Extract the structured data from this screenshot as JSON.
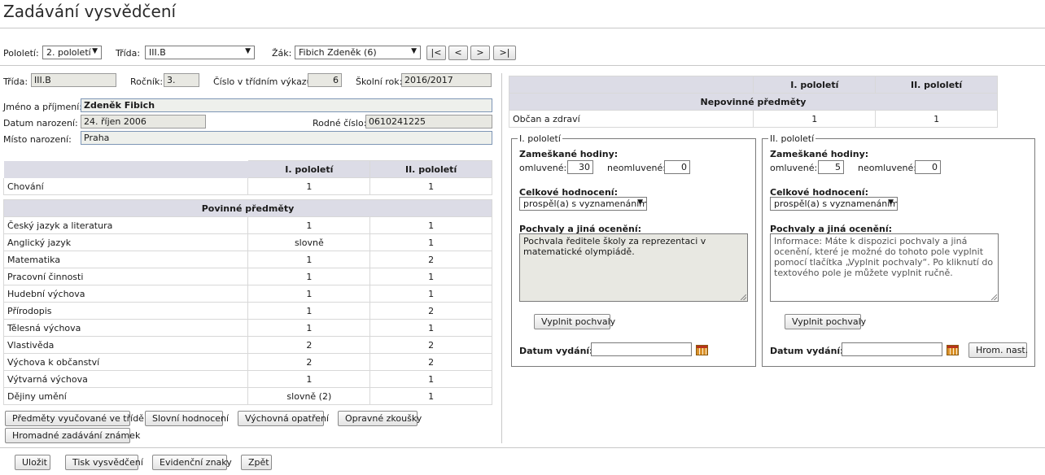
{
  "title": "Zadávání vysvědčení",
  "filters": {
    "pololeti_label": "Pololetí:",
    "pololeti_value": "2. pololetí",
    "trida_label": "Třída:",
    "trida_value": "III.B",
    "zak_label": "Žák:",
    "zak_value": "Fibich Zdeněk (6)",
    "nav_first": "|<",
    "nav_prev": "<",
    "nav_next": ">",
    "nav_last": ">|"
  },
  "student": {
    "trida_label": "Třída:",
    "trida_value": "III.B",
    "rocnik_label": "Ročník:",
    "rocnik_value": "3.",
    "cislo_label": "Číslo v třídním výkazu:",
    "cislo_value": "6",
    "rok_label": "Školní rok:",
    "rok_value": "2016/2017",
    "jmeno_label": "Jméno a příjmení:",
    "jmeno_value": "Zdeněk Fibich",
    "datum_label": "Datum narození:",
    "datum_value": "24. říjen 2006",
    "rc_label": "Rodné číslo:",
    "rc_value": "0610241225",
    "misto_label": "Místo narození:",
    "misto_value": "Praha"
  },
  "grades": {
    "col1": "I. pololetí",
    "col2": "II. pololetí",
    "chovani": {
      "name": "Chování",
      "h1": "1",
      "h2": "1"
    },
    "povinne_title": "Povinné předměty",
    "subjects": [
      {
        "name": "Český jazyk a literatura",
        "h1": "1",
        "h2": "1"
      },
      {
        "name": "Anglický jazyk",
        "h1": "slovně",
        "h2": "1"
      },
      {
        "name": "Matematika",
        "h1": "1",
        "h2": "2"
      },
      {
        "name": "Pracovní činnosti",
        "h1": "1",
        "h2": "1"
      },
      {
        "name": "Hudební výchova",
        "h1": "1",
        "h2": "1"
      },
      {
        "name": "Přírodopis",
        "h1": "1",
        "h2": "2"
      },
      {
        "name": "Tělesná výchova",
        "h1": "1",
        "h2": "1"
      },
      {
        "name": "Vlastivěda",
        "h1": "2",
        "h2": "2"
      },
      {
        "name": "Výchova k občanství",
        "h1": "2",
        "h2": "2"
      },
      {
        "name": "Výtvarná výchova",
        "h1": "1",
        "h2": "1"
      },
      {
        "name": "Dějiny umění",
        "h1": "slovně (2)",
        "h2": "1"
      }
    ]
  },
  "left_buttons": {
    "predmety": "Předměty vyučované ve třídě",
    "slovni": "Slovní hodnocení",
    "vychovna": "Výchovná opatření",
    "opravne": "Opravné zkoušky",
    "hromadne": "Hromadné zadávání známek"
  },
  "nepovinne": {
    "col1": "I. pololetí",
    "col2": "II. pololetí",
    "title": "Nepovinné předměty",
    "rows": [
      {
        "name": "Občan a zdraví",
        "h1": "1",
        "h2": "1"
      }
    ]
  },
  "term1": {
    "legend": "I. pololetí",
    "absence_label": "Zameškané hodiny:",
    "omluvene_label": "omluvené:",
    "omluvene_value": "30",
    "neomluvene_label": "neomluvené:",
    "neomluvene_value": "0",
    "overall_label": "Celkové hodnocení:",
    "overall_value": "prospěl(a) s vyznamenáním",
    "praise_label": "Pochvaly a jiná ocenění:",
    "praise_text": "Pochvala ředitele školy za reprezentaci v matematické olympiádě.",
    "fill_button": "Vyplnit pochvaly",
    "date_label": "Datum vydání:",
    "date_value": ""
  },
  "term2": {
    "legend": "II. pololetí",
    "absence_label": "Zameškané hodiny:",
    "omluvene_label": "omluvené:",
    "omluvene_value": "5",
    "neomluvene_label": "neomluvené:",
    "neomluvene_value": "0",
    "overall_label": "Celkové hodnocení:",
    "overall_value": "prospěl(a) s vyznamenáním",
    "praise_label": "Pochvaly a jiná ocenění:",
    "praise_text": "Informace: Máte k dispozici pochvaly a jiná ocenění, které je možné do tohoto pole vyplnit pomocí tlačítka „Vyplnit pochvaly“. Po kliknutí do textového pole je můžete vyplnit ručně.",
    "fill_button": "Vyplnit pochvaly",
    "date_label": "Datum vydání:",
    "date_value": "",
    "hrom_button": "Hrom. nast."
  },
  "footer": {
    "ulozit": "Uložit",
    "tisk": "Tisk vysvědčení",
    "evidencni": "Evidenční znaky",
    "zpet": "Zpět"
  }
}
